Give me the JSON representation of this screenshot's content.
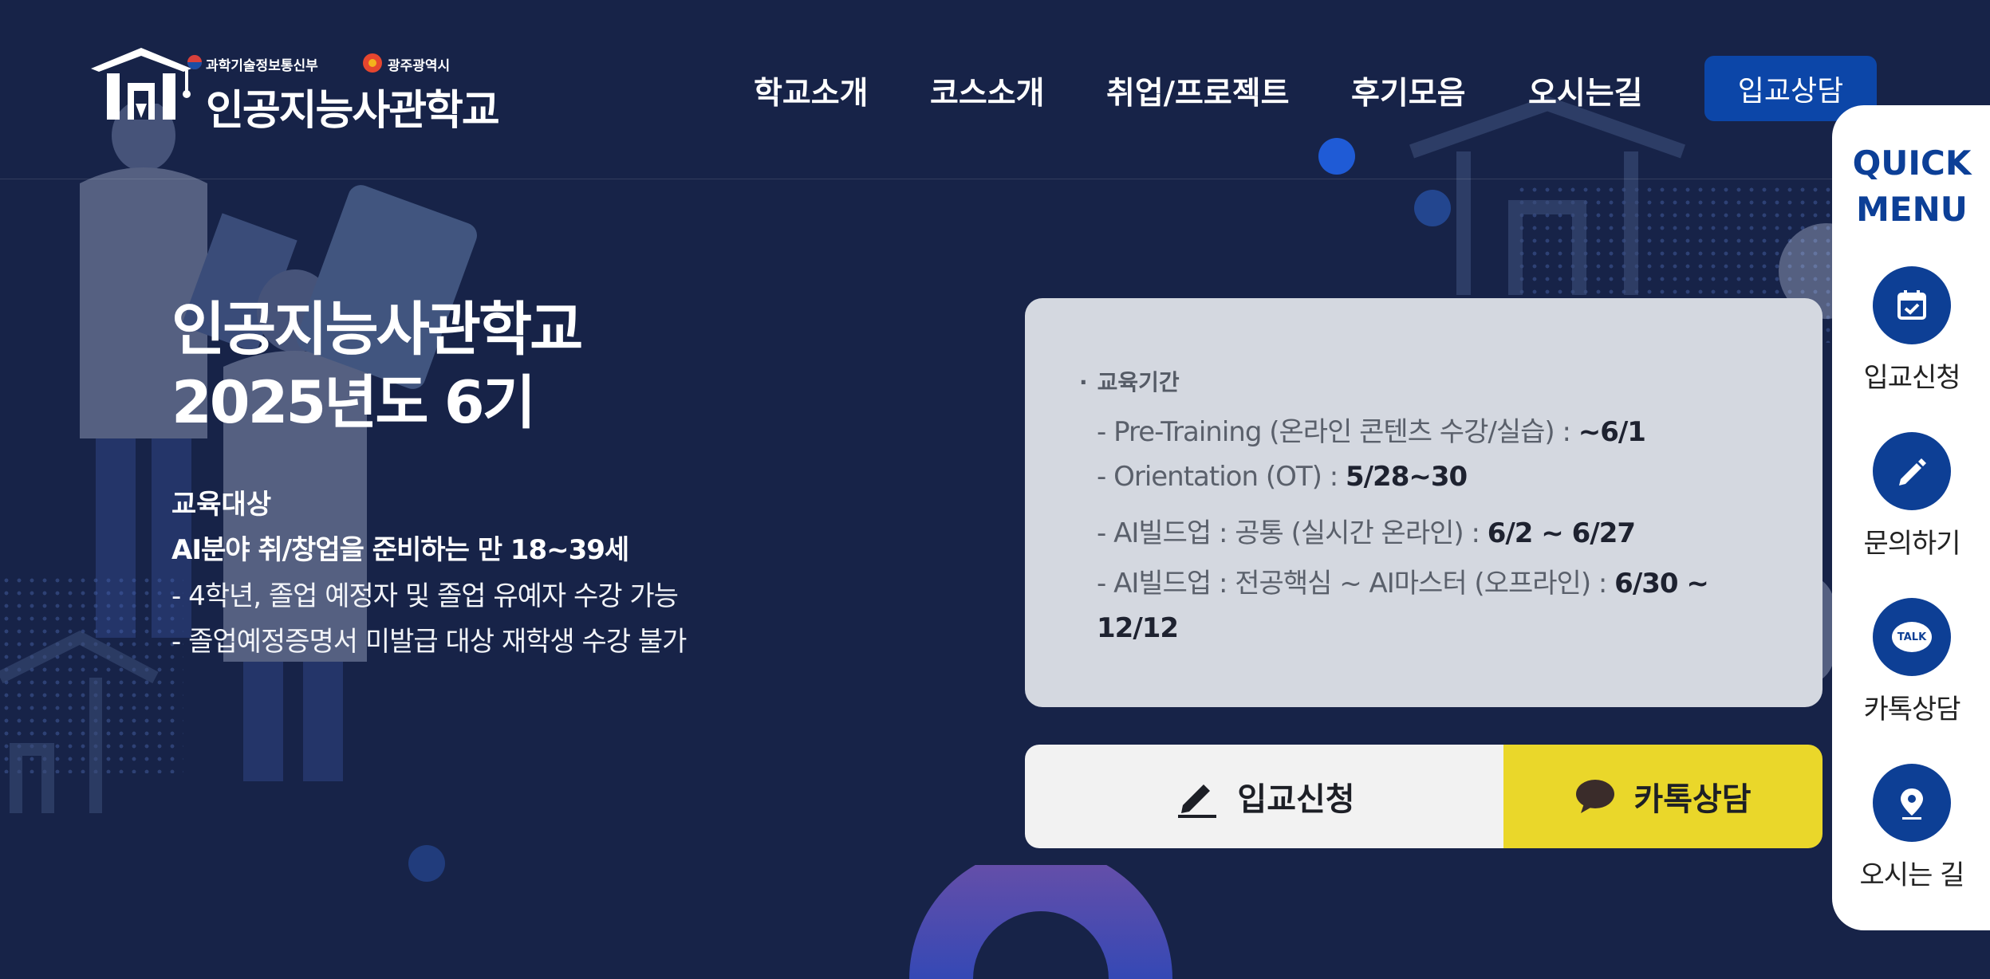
{
  "header": {
    "logo_text": "인공지능사관학교",
    "logo_sub_1": "과학기술정보통신부",
    "logo_sub_2": "광주광역시",
    "nav": [
      "학교소개",
      "코스소개",
      "취업/프로젝트",
      "후기모음",
      "오시는길"
    ],
    "cta_label": "입교상담"
  },
  "hero": {
    "title_line1": "인공지능사관학교",
    "title_line2": "2025년도 6기",
    "target_label": "교육대상",
    "target_main": "AI분야 취/창업을 준비하는 만 18~39세",
    "target_lines": [
      "- 4학년, 졸업 예정자 및 졸업 유예자 수강 가능",
      "- 졸업예정증명서 미발급 대상 재학생 수강 불가"
    ]
  },
  "info_card": {
    "heading": "교육기간",
    "lines": [
      {
        "label": "- Pre-Training (온라인 콘텐츠 수강/실습) : ",
        "value": "~6/1"
      },
      {
        "label": "- Orientation (OT) : ",
        "value": "5/28~30"
      },
      {
        "label": "- AI빌드업 : 공통 (실시간 온라인) : ",
        "value": "6/2 ~ 6/27"
      },
      {
        "label": "- AI빌드업 : 전공핵심 ~ AI마스터 (오프라인) : ",
        "value": "6/30 ~"
      }
    ],
    "wrap_value": "12/12"
  },
  "actions": {
    "apply_label": "입교신청",
    "kakao_label": "카톡상담"
  },
  "quick_menu": {
    "title_line1": "QUICK",
    "title_line2": "MENU",
    "items": [
      {
        "label": "입교신청",
        "icon": "calendar-check-icon"
      },
      {
        "label": "문의하기",
        "icon": "pencil-icon"
      },
      {
        "label": "카톡상담",
        "icon": "talk-bubble-icon"
      },
      {
        "label": "오시는 길",
        "icon": "location-pin-icon"
      }
    ],
    "talk_text": "TALK"
  },
  "colors": {
    "background": "#172348",
    "brand_blue": "#0c46a8",
    "kakao_yellow": "#ead72a",
    "card_gray": "#d4d8e0"
  }
}
